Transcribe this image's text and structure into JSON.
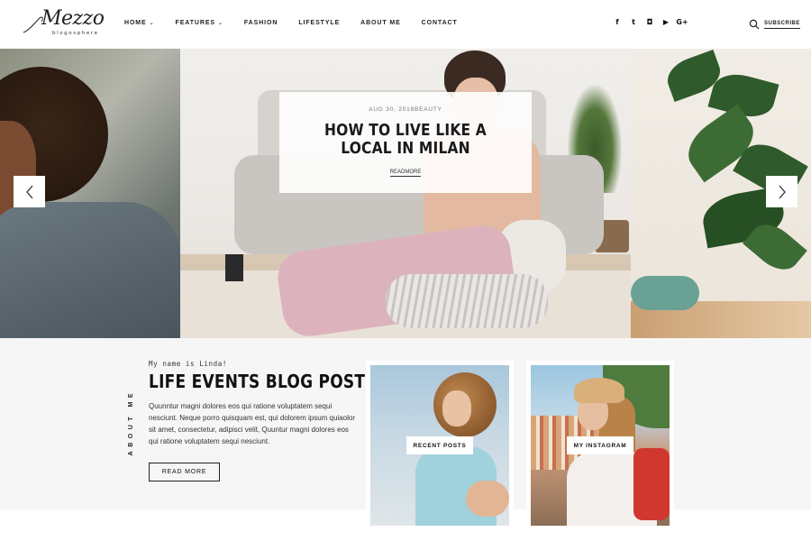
{
  "logo": {
    "name": "Mezzo",
    "tagline": "blogosphere"
  },
  "nav": {
    "items": [
      {
        "label": "HOME",
        "has_caret": true
      },
      {
        "label": "FEATURES",
        "has_caret": true
      },
      {
        "label": "FASHION",
        "has_caret": false
      },
      {
        "label": "LIFESTYLE",
        "has_caret": false
      },
      {
        "label": "ABOUT ME",
        "has_caret": false
      },
      {
        "label": "CONTACT",
        "has_caret": false
      }
    ],
    "caret_glyph": "⌄"
  },
  "social": {
    "icons": [
      "facebook-icon",
      "twitter-icon",
      "flickr-icon",
      "youtube-icon",
      "google-plus-icon"
    ],
    "glyphs": [
      "f",
      "t",
      "◘",
      "▶",
      "G+"
    ]
  },
  "header_right": {
    "subscribe_label": "SUBSCRIBE",
    "search_icon": "search-icon"
  },
  "slider": {
    "date": "AUG 30, 2018",
    "category": "BEAUTY",
    "date_category": "AUG 30, 2018BEAUTY",
    "title": "HOW TO LIVE LIKE A LOCAL IN MILAN",
    "read_more": "READMORE",
    "prev_icon": "chevron-left-icon",
    "next_icon": "chevron-right-icon"
  },
  "about": {
    "vertical_label": "ABOUT ME",
    "kicker": "My name is Linda!",
    "title": "LIFE EVENTS BLOG POSTS : )",
    "body": "Quunntur magni dolores eos qui ratione voluptatem sequi nesciunt. Neque porro quisquam est, qui dolorem ipsum quiaolor sit amet, consectetur, adipisci velit, Quuntur magni dolores eos qui ratione voluptatem sequi nesciunt.",
    "button_label": "READ MORE"
  },
  "tiles": [
    {
      "label": "RECENT POSTS"
    },
    {
      "label": "MY INSTAGRAM"
    }
  ],
  "colors": {
    "text": "#111111",
    "section_bg": "#f6f6f6",
    "card_bg": "#ffffff"
  }
}
